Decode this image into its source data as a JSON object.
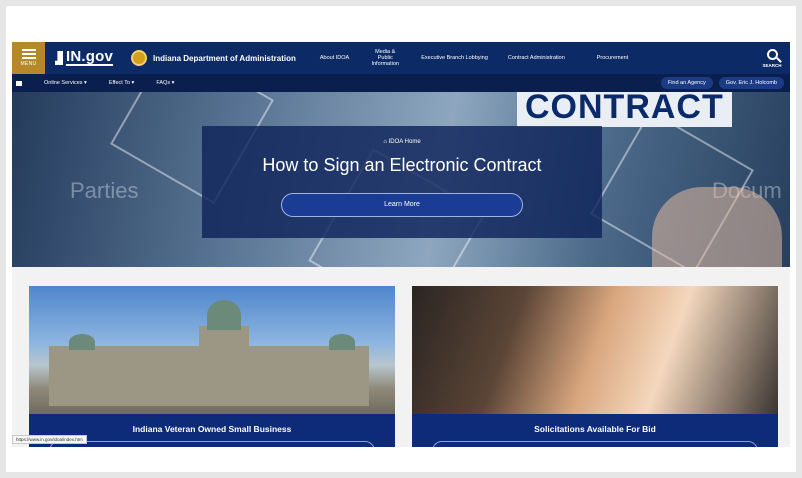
{
  "header": {
    "menu_label": "MENU",
    "logo_text": "IN.gov",
    "agency_name": "Indiana Department of Administration",
    "nav": [
      {
        "label": "About IDOA"
      },
      {
        "label": "Media & Public Information"
      },
      {
        "label": "Executive Branch Lobbying"
      },
      {
        "label": "Contract Administration"
      },
      {
        "label": "Procurement"
      }
    ],
    "search_label": "SEARCH"
  },
  "subnav": {
    "items": [
      {
        "label": "Online Services ▾"
      },
      {
        "label": "Effect To ▾"
      },
      {
        "label": "FAQs ▾"
      }
    ],
    "pills": [
      {
        "label": "Find an Agency"
      },
      {
        "label": "Gov. Eric J. Holcomb"
      }
    ]
  },
  "hero": {
    "bg_words": [
      "Parties",
      "Docum"
    ],
    "contract_word": "CONTRACT",
    "breadcrumb": "IDOA Home",
    "title": "How to Sign an Electronic Contract",
    "button_label": "Learn More"
  },
  "cards": [
    {
      "title": "Indiana Veteran Owned Small Business"
    },
    {
      "title": "Solicitations Available For Bid"
    }
  ],
  "status_bar": {
    "url": "https://www.in.gov/idoa/index.htm"
  },
  "colors": {
    "nav_bg": "#0b2a66",
    "menu_gold": "#b5892a",
    "card_label_bg": "#0d2b78"
  }
}
